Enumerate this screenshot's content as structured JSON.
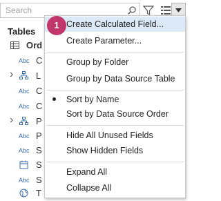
{
  "search": {
    "placeholder": "Search"
  },
  "panel": {
    "title": "Tables",
    "table": {
      "name": "Ord"
    },
    "fields": [
      {
        "type": "abc",
        "name": "C",
        "expandable": false,
        "icon": ""
      },
      {
        "type": "icon",
        "name": "L",
        "expandable": true,
        "icon": "hierarchy-icon"
      },
      {
        "type": "abc",
        "name": "C",
        "expandable": false,
        "icon": ""
      },
      {
        "type": "abc",
        "name": "C",
        "expandable": false,
        "icon": ""
      },
      {
        "type": "icon",
        "name": "P",
        "expandable": true,
        "icon": "hierarchy-icon"
      },
      {
        "type": "abc",
        "name": "P",
        "expandable": false,
        "icon": ""
      },
      {
        "type": "abc",
        "name": "S",
        "expandable": false,
        "icon": ""
      },
      {
        "type": "icon",
        "name": "S",
        "expandable": false,
        "icon": "calendar-icon"
      },
      {
        "type": "abc",
        "name": "S",
        "expandable": false,
        "icon": ""
      },
      {
        "type": "icon",
        "name": "T",
        "expandable": false,
        "icon": "geo-icon"
      }
    ]
  },
  "menu": {
    "items": [
      {
        "label": "Create Calculated Field...",
        "highlighted": true,
        "checked": false
      },
      {
        "label": "Create Parameter...",
        "highlighted": false,
        "checked": false
      },
      {
        "label": "Group by Folder",
        "highlighted": false,
        "checked": false
      },
      {
        "label": "Group by Data Source Table",
        "highlighted": false,
        "checked": false
      },
      {
        "label": "Sort by Name",
        "highlighted": false,
        "checked": true
      },
      {
        "label": "Sort by Data Source Order",
        "highlighted": false,
        "checked": false
      },
      {
        "label": "Hide All Unused Fields",
        "highlighted": false,
        "checked": false
      },
      {
        "label": "Show Hidden Fields",
        "highlighted": false,
        "checked": false
      },
      {
        "label": "Expand All",
        "highlighted": false,
        "checked": false
      },
      {
        "label": "Collapse All",
        "highlighted": false,
        "checked": false
      }
    ]
  },
  "badge": {
    "number": "1",
    "color": "#c2376b"
  },
  "colors": {
    "highlight": "#dce9f7",
    "abc": "#3c6ea8"
  }
}
